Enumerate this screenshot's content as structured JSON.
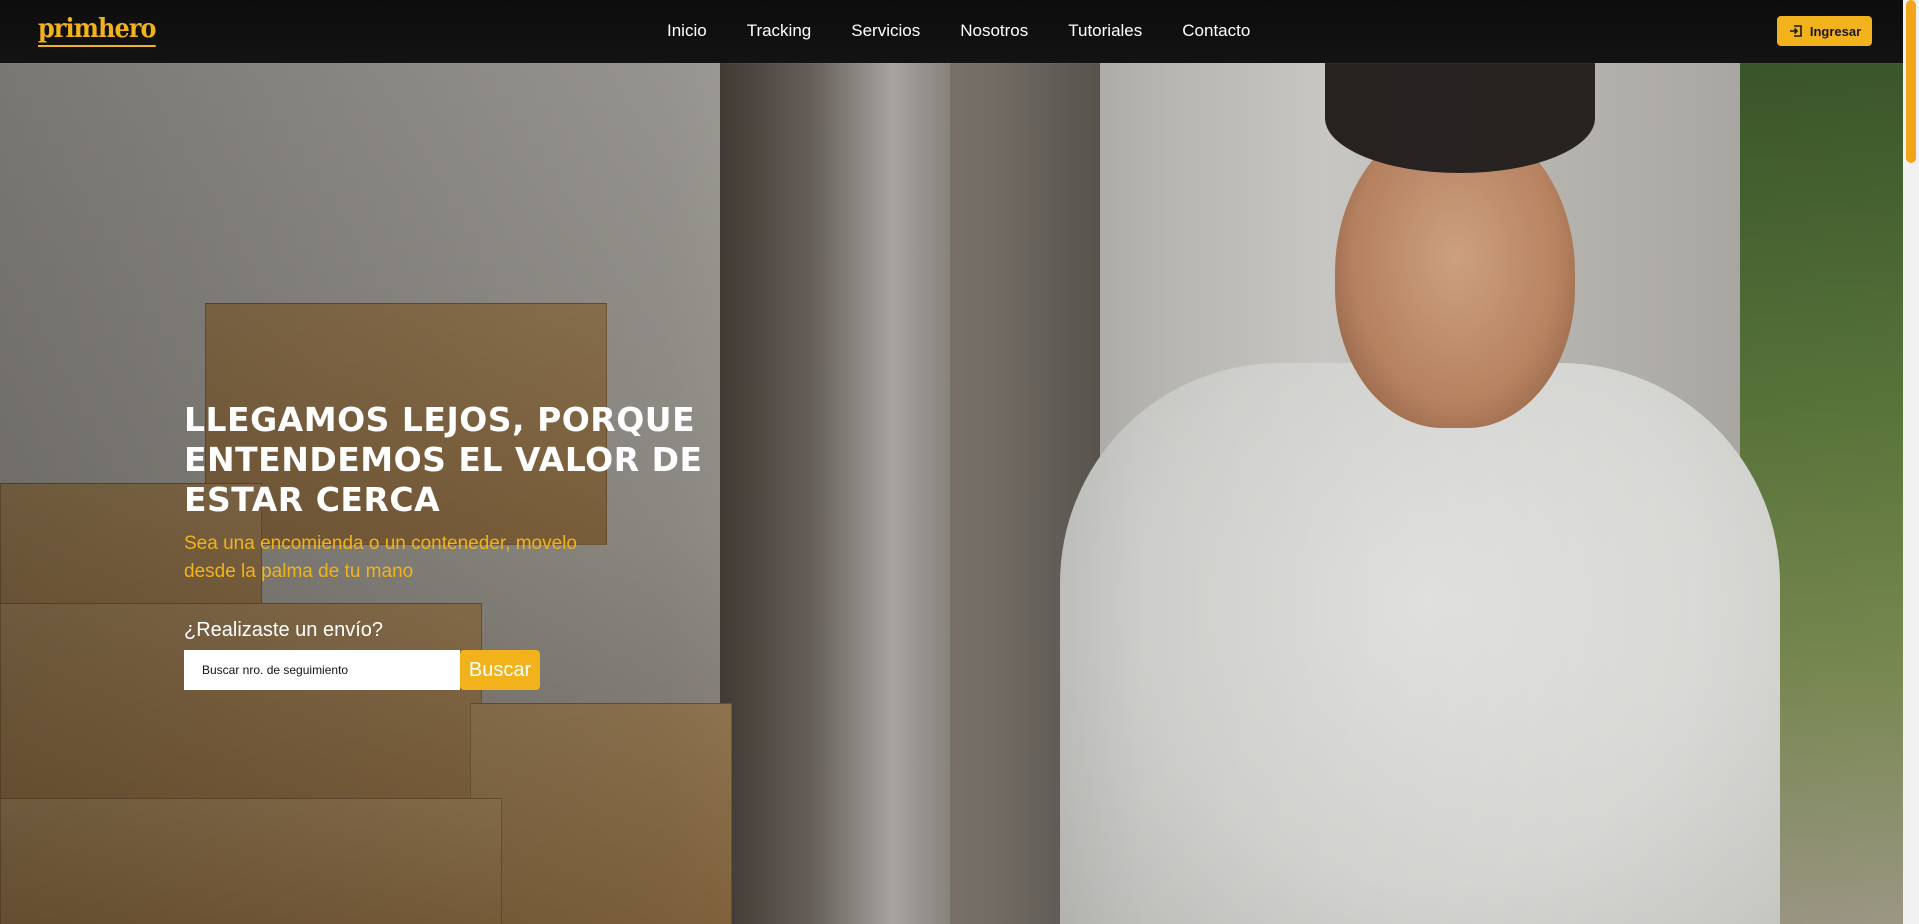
{
  "brand": {
    "logo_text": "primhero",
    "accent_color": "#f2b21b"
  },
  "nav": {
    "items": [
      {
        "label": "Inicio"
      },
      {
        "label": "Tracking"
      },
      {
        "label": "Servicios"
      },
      {
        "label": "Nosotros"
      },
      {
        "label": "Tutoriales"
      },
      {
        "label": "Contacto"
      }
    ],
    "login_label": "Ingresar",
    "login_icon": "login-icon"
  },
  "hero": {
    "headline": "LLEGAMOS LEJOS, PORQUE ENTENDEMOS EL VALOR DE ESTAR CERCA",
    "subtitle": "Sea una encomienda o un conteneder, movelo desde la palma de tu mano",
    "question": "¿Realizaste un envío?",
    "search": {
      "placeholder": "Buscar nro. de seguimiento",
      "value": "",
      "button_label": "Buscar"
    }
  }
}
